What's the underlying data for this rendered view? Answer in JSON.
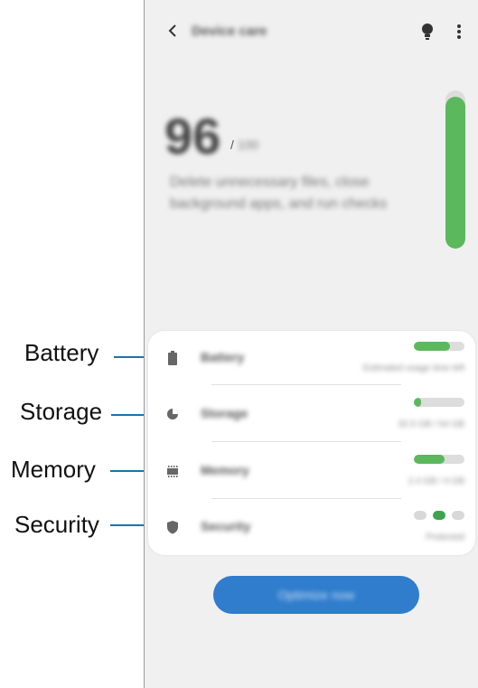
{
  "header": {
    "title": "Device care",
    "back_icon": "chevron-left-icon",
    "tip_icon": "lightbulb-icon",
    "more_icon": "more-vertical-icon"
  },
  "score": {
    "value": "96",
    "max": "100",
    "slash": "/",
    "level_percent": 96,
    "description": "Delete unnecessary files, close background apps, and run checks",
    "bar_color": "#5cb85c"
  },
  "items": [
    {
      "label": "Battery",
      "status": "Estimated usage time left",
      "icon": "battery-icon",
      "level_percent": 72
    },
    {
      "label": "Storage",
      "status": "32.5 GB / 64 GB",
      "icon": "storage-pie-icon",
      "level_percent": 15
    },
    {
      "label": "Memory",
      "status": "2.4 GB / 4 GB",
      "icon": "memory-chip-icon",
      "level_percent": 60
    },
    {
      "label": "Security",
      "status": "Protected",
      "icon": "shield-icon",
      "active_dot": 2
    }
  ],
  "action": {
    "optimize_label": "Optimize now",
    "color": "#2f7dcc"
  },
  "callouts": {
    "battery": "Battery",
    "storage": "Storage",
    "memory": "Memory",
    "security": "Security",
    "line_color": "#1e73a8"
  }
}
